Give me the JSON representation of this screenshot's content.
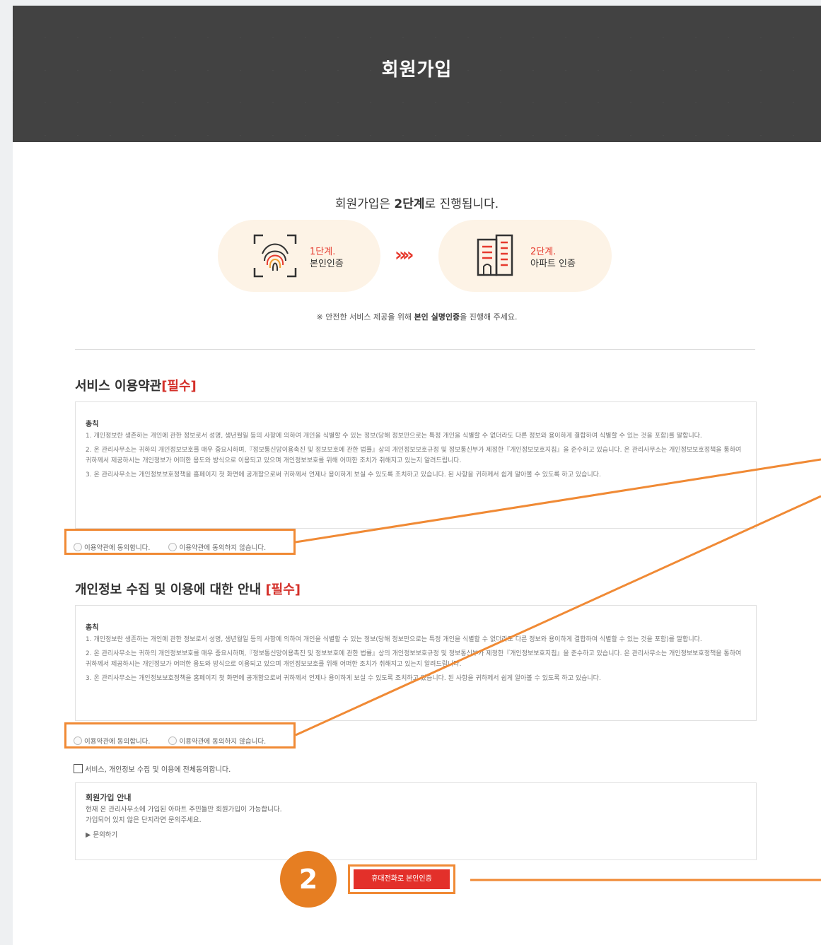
{
  "header": {
    "title": "회원가입"
  },
  "intro": {
    "prefix": "회원가입은 ",
    "bold": "2단계",
    "suffix": "로 진행됩니다."
  },
  "steps": [
    {
      "num": "1단계.",
      "name": "본인인증",
      "icon": "fingerprint-icon"
    },
    {
      "num": "2단계.",
      "name": "아파트 인증",
      "icon": "building-icon"
    }
  ],
  "arrows": "»»",
  "notice": {
    "prefix": "※ 안전한 서비스 제공을 위해 ",
    "bold": "본인 실명인증",
    "suffix": "을 진행해 주세요."
  },
  "service_terms": {
    "title": "서비스 이용약관",
    "required": "[필수]",
    "heading": "총칙",
    "paragraphs": [
      "1. 개인정보란 생존하는 개인에 관한 정보로서 성명, 생년월일 등의 사항에 의하여 개인을 식별할 수 있는 정보(당해 정보만으로는 특정 개인을 식별할 수 없더라도 다른 정보와 용이하게 결합하여 식별할 수 있는 것을 포함)를 말합니다.",
      "2. 온 관리사무소는 귀하의 개인정보보호를 매우 중요시하며,『정보통신망이용촉진 및 정보보호에 관한 법률』상의 개인정보보호규정 및 정보통신부가 제정한『개인정보보호지침』을 준수하고 있습니다. 온 관리사무소는 개인정보보호정책을 통하여 귀하께서 제공하시는 개인정보가 어떠한 용도와 방식으로 이용되고 있으며 개인정보보호를 위해 어떠한 조치가 취해지고 있는지 알려드립니다.",
      "3. 온 관리사무소는 개인정보보호정책을 홈페이지 첫 화면에 공개함으로써 귀하께서 언제나 용이하게 보실 수 있도록 조치하고 있습니다. 된 사항을 귀하께서 쉽게 알아볼 수 있도록 하고 있습니다."
    ],
    "agree": "이용약관에 동의합니다.",
    "disagree": "이용약관에 동의하지 않습니다."
  },
  "privacy_terms": {
    "title": "개인정보 수집 및 이용에 대한 안내 ",
    "required": "[필수]",
    "heading": "총칙",
    "paragraphs": [
      "1. 개인정보란 생존하는 개인에 관한 정보로서 성명, 생년월일 등의 사항에 의하여 개인을 식별할 수 있는 정보(당해 정보만으로는 특정 개인을 식별할 수 없더라도 다른 정보와 용이하게 결합하여 식별할 수 있는 것을 포함)를 말합니다.",
      "2. 온 관리사무소는 귀하의 개인정보보호를 매우 중요시하며,『정보통신망이용촉진 및 정보보호에 관한 법률』상의 개인정보보호규정 및 정보통신부가 제정한『개인정보보호지침』을 준수하고 있습니다. 온 관리사무소는 개인정보보호정책을 통하여 귀하께서 제공하시는 개인정보가 어떠한 용도와 방식으로 이용되고 있으며 개인정보보호를 위해 어떠한 조치가 취해지고 있는지 알려드립니다.",
      "3. 온 관리사무소는 개인정보보호정책을 홈페이지 첫 화면에 공개함으로써 귀하께서 언제나 용이하게 보실 수 있도록 조치하고 있습니다. 된 사항을 귀하께서 쉽게 알아볼 수 있도록 하고 있습니다."
    ],
    "agree": "이용약관에 동의합니다.",
    "disagree": "이용약관에 동의하지 않습니다."
  },
  "agree_all": "서비스, 개인정보 수집 및 이용에 전체동의합니다.",
  "join_info": {
    "title": "회원가입 안내",
    "line1": "현재 온 관리사무소에 가입된 아파트 주민들만 회원가입이 가능합니다.",
    "line2": "가입되어 있지 않은 단지라면 문의주세요.",
    "inquiry": "▶ 문의하기"
  },
  "badge": "2",
  "cert_button": "휴대전화로 본인인증",
  "colors": {
    "accent": "#e3302a",
    "callout": "#f08a35",
    "banner": "#424242"
  }
}
